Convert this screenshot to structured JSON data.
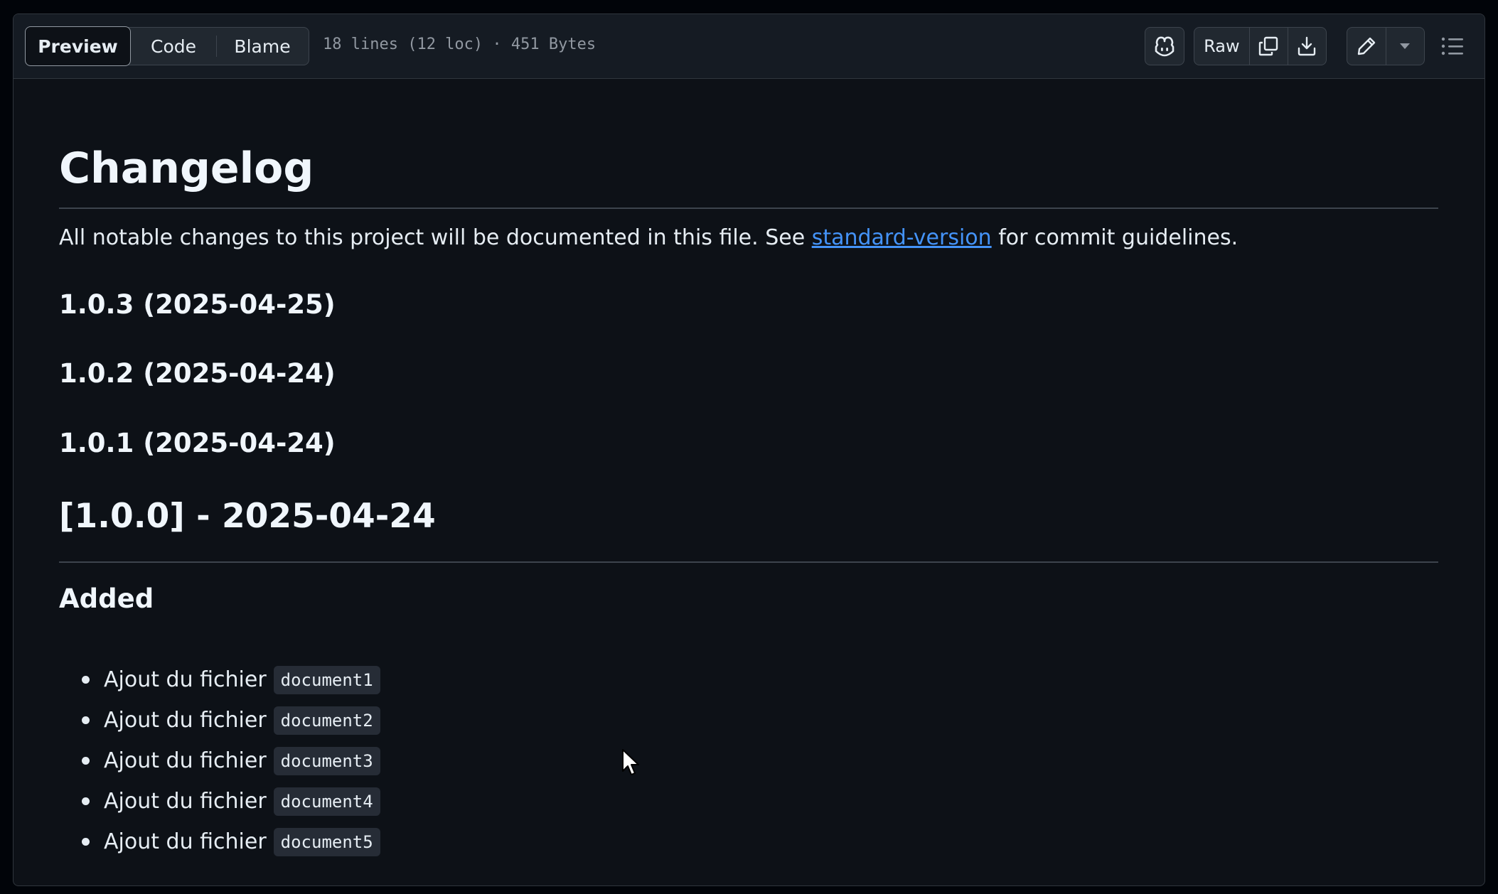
{
  "header": {
    "tabs": [
      {
        "label": "Preview",
        "active": true
      },
      {
        "label": "Code",
        "active": false
      },
      {
        "label": "Blame",
        "active": false
      }
    ],
    "file_info": "18 lines (12 loc) · 451 Bytes",
    "toolbar": {
      "copilot_icon": "copilot-icon",
      "raw_label": "Raw",
      "copy_icon": "copy-icon",
      "download_icon": "download-icon",
      "edit_icon": "pencil-icon",
      "more_icon": "triangle-down-icon",
      "outline_icon": "list-unordered-icon"
    }
  },
  "content": {
    "title": "Changelog",
    "intro_before": "All notable changes to this project will be documented in this file. See ",
    "intro_link": "standard-version",
    "intro_after": " for commit guidelines.",
    "versions": [
      "1.0.3 (2025-04-25)",
      "1.0.2 (2025-04-24)",
      "1.0.1 (2025-04-24)"
    ],
    "release_heading": "[1.0.0] - 2025-04-24",
    "added_heading": "Added",
    "added_items": [
      {
        "text": "Ajout du fichier",
        "code": "document1"
      },
      {
        "text": "Ajout du fichier",
        "code": "document2"
      },
      {
        "text": "Ajout du fichier",
        "code": "document3"
      },
      {
        "text": "Ajout du fichier",
        "code": "document4"
      },
      {
        "text": "Ajout du fichier",
        "code": "document5"
      }
    ]
  },
  "colors": {
    "page_bg": "#010409",
    "content_bg": "#0d1117",
    "header_bg": "#151b23",
    "border": "#30363d",
    "link": "#4493f8",
    "text": "#e6edf3"
  }
}
